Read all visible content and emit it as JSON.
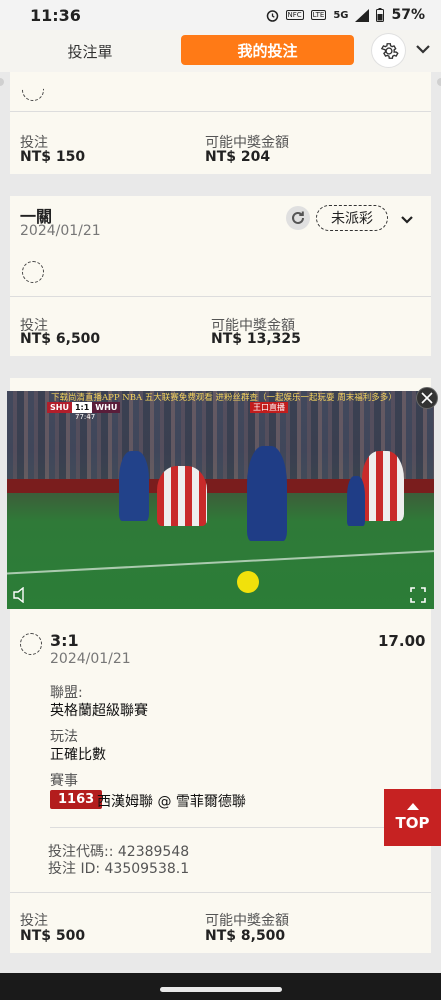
{
  "status_bar": {
    "time": "11:36",
    "network": "5G",
    "battery": "57%",
    "nfc": "NFC",
    "lte": "LTE",
    "icons": [
      "alarm-icon",
      "nfc-icon",
      "lte-icon",
      "signal-icon",
      "battery-icon"
    ]
  },
  "header": {
    "tab_betslip": "投注單",
    "tab_mybets": "我的投注",
    "accent_color": "#ff7a16"
  },
  "cards": [
    {
      "stake_label": "投注",
      "stake_value": "NT$ 150",
      "payout_label": "可能中獎金額",
      "payout_value": "NT$ 204"
    },
    {
      "title": "一關",
      "date": "2024/01/21",
      "status": "未派彩",
      "stake_label": "投注",
      "stake_value": "NT$ 6,500",
      "payout_label": "可能中獎金額",
      "payout_value": "NT$ 13,325"
    },
    {
      "selection": "3:1",
      "odds": "17.00",
      "date": "2024/01/21",
      "league_label": "聯盟:",
      "league_value": "英格蘭超級聯賽",
      "market_label": "玩法",
      "market_value": "正確比數",
      "event_label": "賽事",
      "event_id": "1163",
      "event_value": "西漢姆聯 @ 雪菲爾德聯",
      "bet_code": "投注代碼:: 42389548",
      "bet_id": "投注 ID: 43509538.1",
      "stake_label": "投注",
      "stake_value": "NT$ 500",
      "payout_label": "可能中獎金額",
      "payout_value": "NT$ 8,500"
    }
  ],
  "video": {
    "marquee": "下载尚清直播APP NBA 五大联赛免费观看 进粉丝群查（一起娱乐一起玩耍 周末福利多多）",
    "home": "SHU",
    "score": "1:1",
    "away": "WHU",
    "clock": "77:47",
    "live_badge": "王口直播"
  },
  "top_button": "TOP"
}
